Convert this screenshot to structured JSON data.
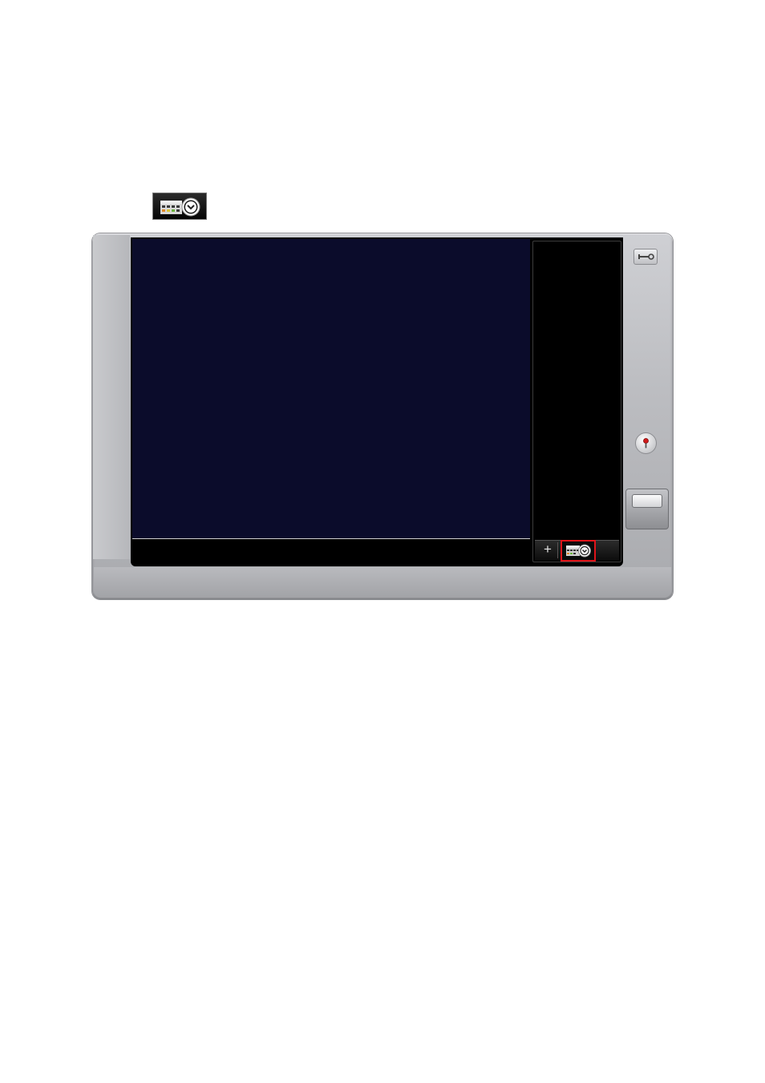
{
  "reference_icon": {
    "icon": "schedule-calendar-clock-icon"
  },
  "device": {
    "top_right_button": {
      "icon": "wrench-key-icon"
    },
    "round_button": {
      "icon": "record-indicator-icon",
      "accent": "#d01a1a"
    },
    "large_button": {
      "icon": "blank-rectangle-button"
    }
  },
  "side_panel": {
    "toolbar": {
      "add_label": "+",
      "schedule_button": {
        "icon": "schedule-calendar-clock-icon",
        "highlight": "#e0141a"
      }
    }
  },
  "colors": {
    "video_background": "#0b0c2b",
    "panel_background": "#000000",
    "chassis": "#bdbec2"
  }
}
